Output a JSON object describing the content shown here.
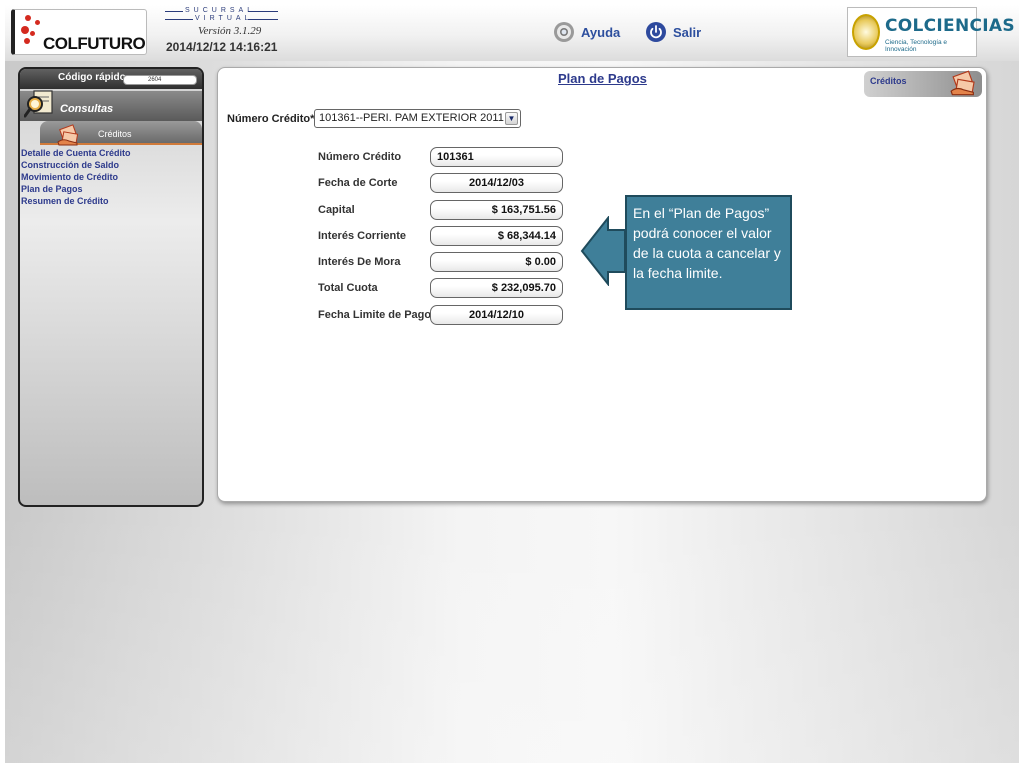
{
  "header": {
    "brand": "COLFUTURO",
    "sucursal_top": "SUCURSAL",
    "sucursal_bottom": "VIRTUAL",
    "version": "Versión 3.1.29",
    "datetime": "2014/12/12 14:16:21",
    "help_label": "Ayuda",
    "logout_label": "Salir",
    "partner_title": "COLCIENCIAS",
    "partner_subtitle": "Ciencia, Tecnología e Innovación"
  },
  "sidebar": {
    "quick_label": "Código rápido",
    "quick_value": "2604",
    "section_label": "Consultas",
    "tab_label": "Créditos",
    "links": [
      "Detalle de Cuenta Crédito",
      "Construcción de Saldo",
      "Movimiento de Crédito",
      "Plan de Pagos",
      "Resumen de Crédito"
    ]
  },
  "main": {
    "title": "Plan de Pagos",
    "corner_tab": "Créditos",
    "credit_select_label": "Número Crédito*",
    "credit_select_value": "101361--PERI. PAM EXTERIOR 2011",
    "fields": [
      {
        "label": "Número Crédito",
        "value": "101361"
      },
      {
        "label": "Fecha de Corte",
        "value": "2014/12/03"
      },
      {
        "label": "Capital",
        "value": "$ 163,751.56"
      },
      {
        "label": "Interés Corriente",
        "value": "$ 68,344.14"
      },
      {
        "label": "Interés De Mora",
        "value": "$ 0.00"
      },
      {
        "label": "Total Cuota",
        "value": "$ 232,095.70"
      },
      {
        "label": "Fecha Limite de Pago",
        "value": "2014/12/10"
      }
    ]
  },
  "callout": {
    "text": "En el “Plan de Pagos” podrá conocer el valor de la cuota a cancelar y la fecha limite."
  },
  "colors": {
    "link_blue": "#2d3a8c",
    "callout_teal": "#3f7f99",
    "brand_red": "#d42a1f"
  },
  "icons": {
    "help": "lifebuoy-icon",
    "logout": "power-icon",
    "consultas": "magnifier-document-icon",
    "creditos": "money-hand-icon",
    "select_arrow": "chevron-down-icon"
  }
}
